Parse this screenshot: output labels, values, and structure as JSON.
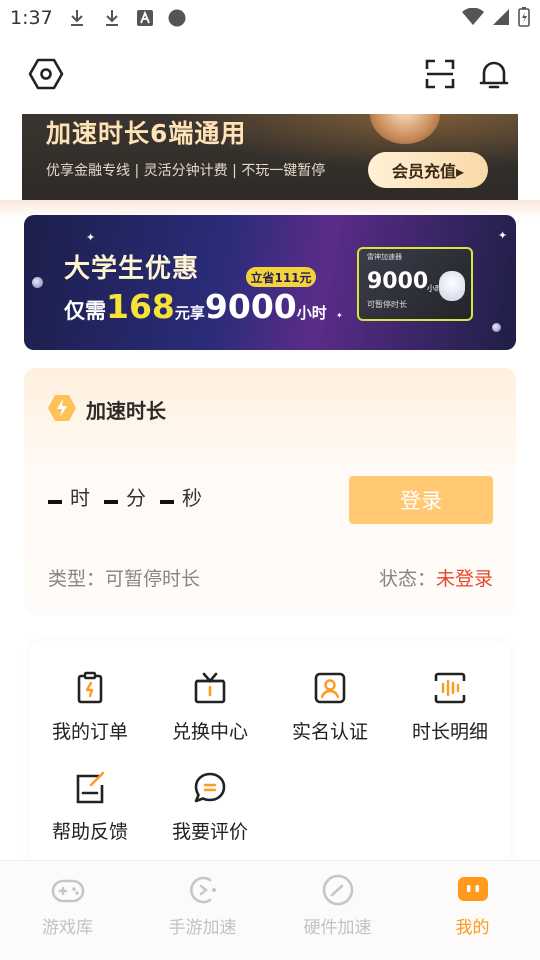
{
  "status_bar": {
    "time": "1:37"
  },
  "header": {
    "left_icon": "hexagon-settings-icon",
    "right_icons": [
      "scan-icon",
      "bell-icon"
    ]
  },
  "top_banner": {
    "title": "加速时长6端通用",
    "subtitle": "优享金融专线 | 灵活分钟计费 | 不玩一键暂停",
    "button_label": "会员充值▸"
  },
  "student_promo": {
    "title": "大学生优惠",
    "save_badge": "立省111元",
    "line_prefix": "仅需",
    "price": "168",
    "price_unit": "元享",
    "hours": "9000",
    "hours_unit": "小时",
    "card": {
      "brand": "雷神加速器",
      "hours": "9000",
      "hours_unit": "小时",
      "subtitle": "可暂停时长"
    }
  },
  "accel_card": {
    "title": "加速时长",
    "timer": {
      "hours_unit": "时",
      "minutes_unit": "分",
      "seconds_unit": "秒"
    },
    "login_button": "登录",
    "type_label": "类型：可暂停时长",
    "status_label": "状态：",
    "status_value": "未登录",
    "colors": {
      "accent": "#ffc871",
      "status": "#e8452a"
    }
  },
  "services": {
    "items": [
      {
        "label": "我的订单",
        "icon": "order-icon"
      },
      {
        "label": "兑换中心",
        "icon": "gift-icon"
      },
      {
        "label": "实名认证",
        "icon": "id-card-icon"
      },
      {
        "label": "时长明细",
        "icon": "duration-icon"
      },
      {
        "label": "帮助反馈",
        "icon": "feedback-icon"
      },
      {
        "label": "我要评价",
        "icon": "comment-icon"
      }
    ]
  },
  "tabbar": {
    "items": [
      {
        "label": "游戏库",
        "icon": "gamepad-icon",
        "active": false
      },
      {
        "label": "手游加速",
        "icon": "mobile-game-icon",
        "active": false
      },
      {
        "label": "硬件加速",
        "icon": "gauge-icon",
        "active": false
      },
      {
        "label": "我的",
        "icon": "profile-icon",
        "active": true
      }
    ],
    "active_color": "#ff9a1f"
  }
}
